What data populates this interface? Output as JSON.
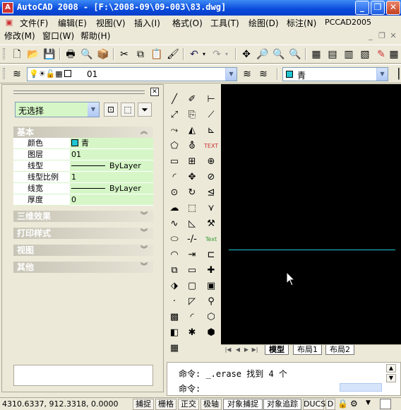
{
  "window": {
    "title": "AutoCAD 2008 - [F:\\2008-09\\09-003\\83.dwg]",
    "app_icon_letter": "A",
    "minimize_glyph": "_",
    "restore_glyph": "❐",
    "close_glyph": "✕"
  },
  "menubar": {
    "items": [
      "文件(F)",
      "编辑(E)",
      "视图(V)",
      "插入(I)",
      "格式(O)",
      "工具(T)",
      "绘图(D)",
      "标注(N)",
      "PCCAD2005"
    ],
    "items_row2": [
      "修改(M)",
      "窗口(W)",
      "帮助(H)"
    ]
  },
  "layers_toolbar": {
    "layer_name": "01",
    "color_name": "青"
  },
  "properties": {
    "selection": "无选择",
    "sections": {
      "basic": "基本",
      "effects3d": "三维效果",
      "plotstyle": "打印样式",
      "view": "视图",
      "misc": "其他"
    },
    "rows": [
      {
        "label": "颜色",
        "value": "青"
      },
      {
        "label": "图层",
        "value": "01"
      },
      {
        "label": "线型",
        "value": "ByLayer"
      },
      {
        "label": "线型比例",
        "value": "1"
      },
      {
        "label": "线宽",
        "value": "ByLayer"
      },
      {
        "label": "厚度",
        "value": "0"
      }
    ]
  },
  "layout_tabs": [
    "模型",
    "布局1",
    "布局2"
  ],
  "command": {
    "line1": "命令: _.erase 找到 4 个",
    "line2": "命令:"
  },
  "status": {
    "coords": "4310.6337, 912.3318, 0.0000",
    "buttons": [
      "捕捉",
      "栅格",
      "正交",
      "极轴",
      "对象捕捉",
      "对象追踪",
      "DUCS",
      "D"
    ]
  },
  "colors": {
    "cyan": "#21C5D2",
    "canvas": "#000000",
    "title_blue": "#0A4ADB",
    "prop_green": "#D6F6C7"
  }
}
